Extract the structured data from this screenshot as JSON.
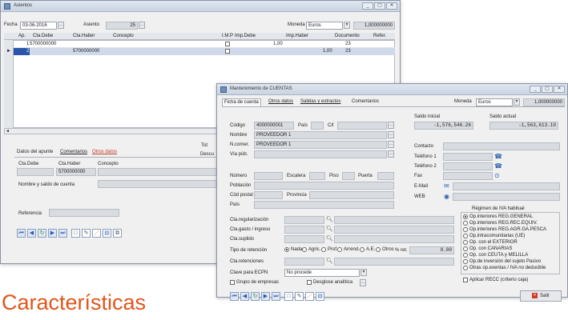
{
  "main_window": {
    "title": "Asientos",
    "window_buttons": [
      "_",
      "▢",
      "✕"
    ],
    "fecha_label": "Fecha",
    "fecha_value": "03-06-2016",
    "asiento_label": "Asiento",
    "asiento_value": "25",
    "moneda_label": "Moneda",
    "moneda_value": "Euros",
    "moneda_rate": "1,000000000",
    "columns": [
      "Ap.",
      "Cta.Debe",
      "Cta.Haber",
      "Concepto",
      "I.M.P",
      "Imp.Debe",
      "Imp.Haber",
      "Documento",
      "Refer."
    ],
    "rows": [
      {
        "ap": "1",
        "debe": "5700000000",
        "haber": "",
        "imp_debe": "1,00",
        "imp_haber": "",
        "doc": "23"
      },
      {
        "ap": "2",
        "debe": "",
        "haber": "5700000000",
        "imp_debe": "",
        "imp_haber": "1,00",
        "doc": "23"
      }
    ],
    "tabs": [
      "Datos del apunte",
      "Comentarios",
      "Otros datos"
    ],
    "detail_headers": [
      "Cta.Debe",
      "Cta.Haber",
      "Concepto"
    ],
    "detail_haber_value": "5700000000",
    "nombre_label": "Nombre y saldo de cuenta",
    "referencia_label": "Referencia",
    "side_label_1": "Tot",
    "side_label_2": "Descu"
  },
  "dialog": {
    "title": "Mantenimiento de CUENTAS",
    "window_buttons": [
      "_",
      "▢",
      "✕"
    ],
    "tabs": [
      "Ficha de cuenta",
      "Otros datos",
      "Salidas y extractos",
      "Comentarios"
    ],
    "moneda_label": "Moneda",
    "moneda_value": "Euros",
    "moneda_rate": "1,000000000",
    "saldo_inicial_label": "Saldo inicial",
    "saldo_inicial_value": "-1,576,546.26",
    "saldo_actual_label": "Saldo actual",
    "saldo_actual_value": "-1,563,613.10",
    "codigo_label": "Código",
    "codigo_value": "4000000001",
    "pais_label": "País",
    "cif_label": "Cif",
    "nombre_label": "Nombre",
    "nombre_value": "PROVEEDOR 1",
    "ncomer_label": "N.comer.",
    "ncomer_value": "PROVEEDOR 1",
    "viapub_label": "Vía púb.",
    "numero_label": "Número",
    "escalera_label": "Escalera",
    "piso_label": "Piso",
    "puerta_label": "Puerta",
    "poblacion_label": "Población",
    "codpostal_label": "Cód postal",
    "provincia_label": "Provincia",
    "pais2_label": "País",
    "contacto_label": "Contacto",
    "telefono1_label": "Teléfono 1",
    "telefono2_label": "Teléfono 2",
    "fax_label": "Fax",
    "email_label": "E-Mail",
    "web_label": "WEB",
    "cta_reg_label": "Cta.regularización",
    "cta_gasto_label": "Cta.gasto / ingreso",
    "cta_suplido_label": "Cta.suplido",
    "tipo_retencion_label": "Tipo de retención",
    "retencion_options": [
      "Nada",
      "Agric.",
      "Prof.",
      "Arrend.",
      "A.E.",
      "Otros"
    ],
    "retencion_selected": "Nada",
    "pct_ret_label": "% ret.",
    "pct_ret_value": "0.00",
    "cta_retenciones_label": "Cta.retenciones",
    "clave_ecpn_label": "Clave para ECPN",
    "clave_ecpn_value": "No procede",
    "grupo_empresas_label": "Grupo de empresas",
    "desglose_label": "Desglose analítica",
    "iva_heading": "Régimen de IVA habitual",
    "iva_options": [
      "Op.interiores REG.GENERAL",
      "Op.interiores REG.REC.EQUIV.",
      "Op.interiores REG.AGR.GA.PESCA",
      "Op.intracomunitarias (UE)",
      "Op. con el EXTERIOR",
      "Op. con CANARIAS",
      "Op. con CEUTA y MELILLA",
      "Op.de inversión del sujeto Pasivo",
      "Otras op.exentas / IVA no deducible"
    ],
    "iva_selected": 0,
    "aplicar_recc_label": "Aplicar RECC (criterio caja)",
    "salir_label": "Salir"
  },
  "heading": "Características"
}
